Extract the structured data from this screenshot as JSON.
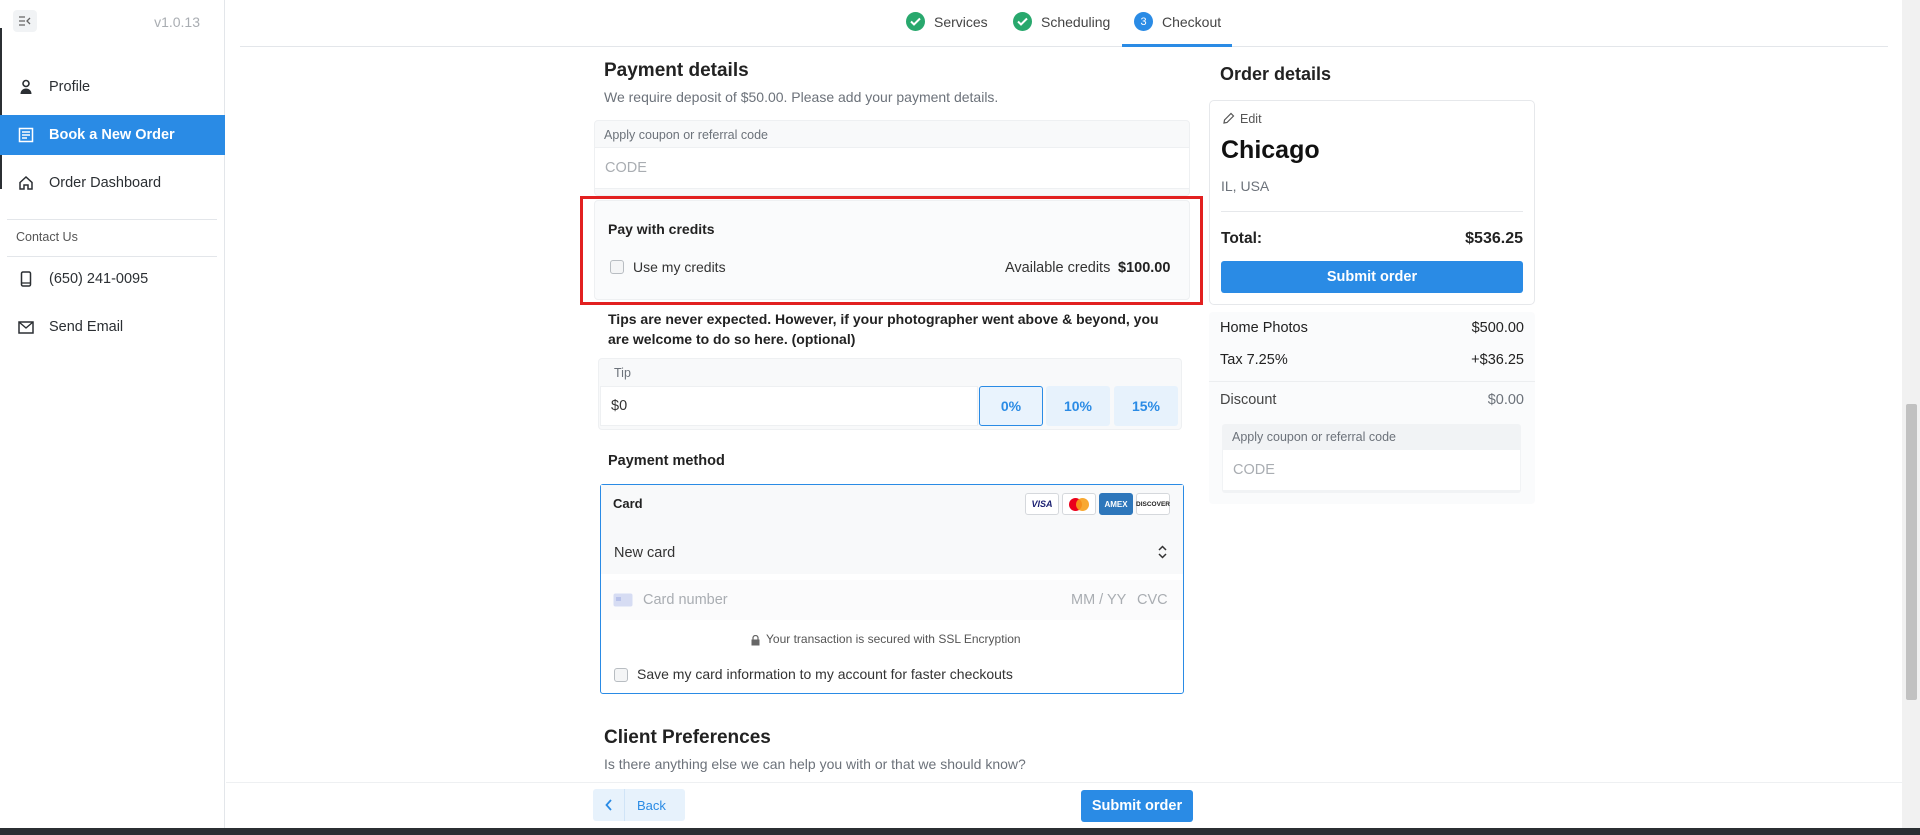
{
  "app": {
    "version": "v1.0.13"
  },
  "sidebar": {
    "items": [
      {
        "label": "Profile",
        "icon": "person-icon"
      },
      {
        "label": "Book a New Order",
        "icon": "book-order-icon"
      },
      {
        "label": "Order Dashboard",
        "icon": "home-icon"
      }
    ],
    "contact_heading": "Contact Us",
    "contact_items": [
      {
        "label": "(650) 241-0095",
        "icon": "phone-icon"
      },
      {
        "label": "Send Email",
        "icon": "mail-icon"
      }
    ]
  },
  "stepper": {
    "steps": [
      {
        "label": "Services",
        "state": "done"
      },
      {
        "label": "Scheduling",
        "state": "done"
      },
      {
        "label": "Checkout",
        "state": "current",
        "number": "3"
      }
    ]
  },
  "payment": {
    "title": "Payment details",
    "subtitle": "We require deposit of $50.00. Please add your payment details.",
    "coupon_label": "Apply coupon or referral code",
    "coupon_placeholder": "CODE",
    "credits_title": "Pay with credits",
    "use_credits_label": "Use my credits",
    "available_credits_label": "Available credits",
    "available_credits_value": "$100.00",
    "tips_text": "Tips are never expected. However, if your photographer went above & beyond, you are welcome to do so here. (optional)",
    "tip_label": "Tip",
    "tip_value": "$0",
    "tip_options": [
      "0%",
      "10%",
      "15%"
    ],
    "tip_selected": "0%",
    "method_title": "Payment method",
    "card_label": "Card",
    "card_brands": [
      "VISA",
      "Mastercard",
      "AMEX",
      "DISCOVER"
    ],
    "card_select": "New card",
    "card_number_placeholder": "Card number",
    "expiry_placeholder": "MM / YY",
    "cvc_placeholder": "CVC",
    "ssl_text": "Your transaction is secured with SSL Encryption",
    "save_card_label": "Save my card information to my account for faster checkouts"
  },
  "client_prefs": {
    "title": "Client Preferences",
    "subtitle": "Is there anything else we can help you with or that we should know?"
  },
  "order": {
    "title": "Order details",
    "edit_label": "Edit",
    "city": "Chicago",
    "region": "IL, USA",
    "total_label": "Total:",
    "total_value": "$536.25",
    "submit_label": "Submit order",
    "lines": [
      {
        "label": "Home Photos",
        "value": "$500.00"
      },
      {
        "label": "Tax 7.25%",
        "value": "+$36.25"
      },
      {
        "label": "Discount",
        "value": "$0.00"
      }
    ],
    "coupon_label": "Apply coupon or referral code",
    "coupon_placeholder": "CODE"
  },
  "footer": {
    "back_label": "Back",
    "submit_label": "Submit order"
  },
  "colors": {
    "accent": "#2a8be5",
    "success": "#28a86d",
    "highlight": "#e22020"
  }
}
